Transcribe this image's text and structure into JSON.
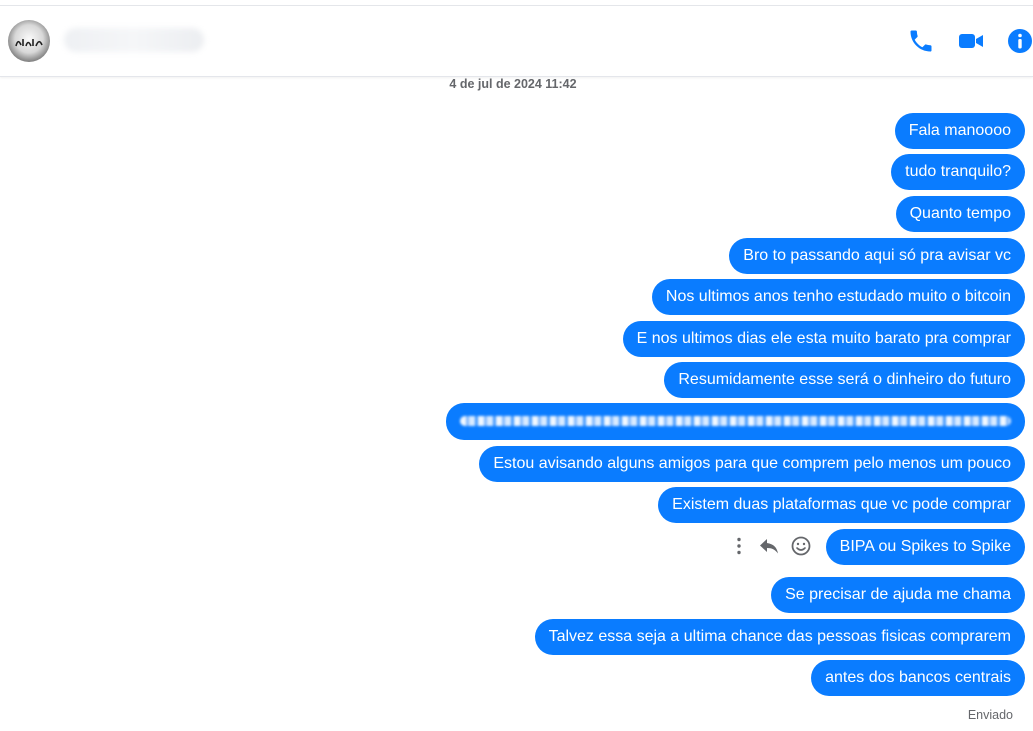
{
  "header": {
    "icons": {
      "call": "phone-icon",
      "video": "video-icon",
      "info": "info-icon"
    },
    "accent": "#0a7cff"
  },
  "conversation": {
    "timestamp": "4 de jul de 2024 11:42",
    "messages": [
      {
        "text": "Fala manoooo"
      },
      {
        "text": "tudo tranquilo?"
      },
      {
        "text": "Quanto tempo"
      },
      {
        "text": "Bro to passando aqui só pra avisar vc"
      },
      {
        "text": "Nos ultimos anos tenho estudado muito o bitcoin"
      },
      {
        "text": "E nos ultimos dias ele esta muito barato pra comprar"
      },
      {
        "text": "Resumidamente esse será o dinheiro do futuro"
      },
      {
        "text": ""
      },
      {
        "text": "Estou avisando alguns amigos para que comprem pelo menos um pouco"
      },
      {
        "text": "Existem duas plataformas que vc pode comprar"
      },
      {
        "text": "BIPA ou Spikes to Spike"
      },
      {
        "text": "Se precisar de ajuda me chama"
      },
      {
        "text": "Talvez essa seja a ultima chance das pessoas fisicas comprarem"
      },
      {
        "text": "antes dos bancos centrais"
      }
    ],
    "hover_actions": [
      "more-icon",
      "reply-icon",
      "react-icon"
    ],
    "status": "Enviado",
    "bubble_color": "#0a7cff"
  }
}
